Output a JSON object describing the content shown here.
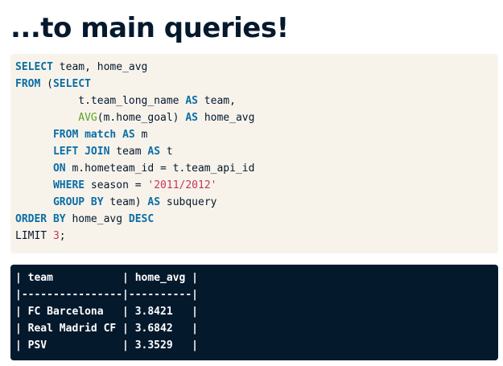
{
  "title": "...to main queries!",
  "code": {
    "line1": {
      "k1": "SELECT",
      "t1": " team, home_avg"
    },
    "line2": {
      "k1": "FROM",
      "t1": " (",
      "k2": "SELECT"
    },
    "line3": {
      "t1": "          t.team_long_name ",
      "k1": "AS",
      "t2": " team,"
    },
    "line4": {
      "indent": "          ",
      "f1": "AVG",
      "t1": "(m.home_goal) ",
      "k1": "AS",
      "t2": " home_avg"
    },
    "line5": {
      "indent": "      ",
      "k1": "FROM",
      "t1": " ",
      "k2": "match",
      "t2": " ",
      "k3": "AS",
      "t3": " m"
    },
    "line6": {
      "indent": "      ",
      "k1": "LEFT JOIN",
      "t1": " team ",
      "k2": "AS",
      "t2": " t"
    },
    "line7": {
      "indent": "      ",
      "k1": "ON",
      "t1": " m.hometeam_id = t.team_api_id"
    },
    "line8": {
      "indent": "      ",
      "k1": "WHERE",
      "t1": " season = ",
      "s1": "'2011/2012'"
    },
    "line9": {
      "indent": "      ",
      "k1": "GROUP BY",
      "t1": " team) ",
      "k2": "AS",
      "t2": " subquery"
    },
    "line10": {
      "k1": "ORDER BY",
      "t1": " home_avg ",
      "k2": "DESC"
    },
    "line11": {
      "t1": "LIMIT ",
      "n1": "3",
      "t2": ";"
    }
  },
  "result": {
    "header": "| team           | home_avg |",
    "separator": "|----------------|----------|",
    "rows": [
      "| FC Barcelona   | 3.8421   |",
      "| Real Madrid CF | 3.6842   |",
      "| PSV            | 3.3529   |"
    ]
  },
  "colors": {
    "keyword": "#0a6ea6",
    "function": "#5ca321",
    "string": "#c7355a",
    "code_bg": "#f7f3eb",
    "result_bg": "#05192d",
    "title": "#05192d"
  }
}
